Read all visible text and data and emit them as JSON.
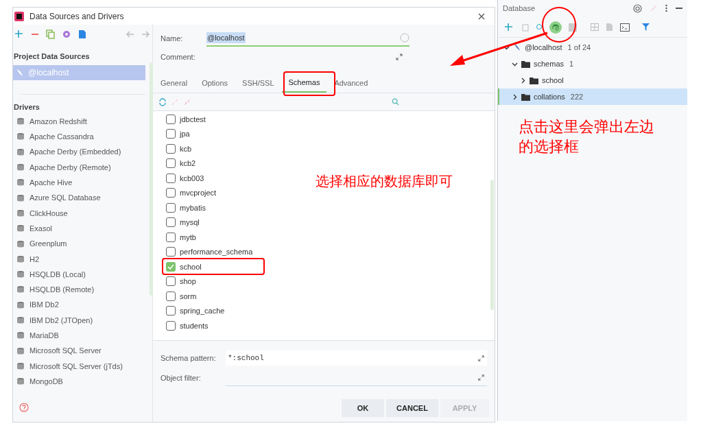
{
  "dialog": {
    "title": "Data Sources and Drivers",
    "project_section": "Project Data Sources",
    "project_items": [
      {
        "label": "@localhost",
        "selected": true
      }
    ],
    "drivers_section": "Drivers",
    "drivers": [
      "Amazon Redshift",
      "Apache Cassandra",
      "Apache Derby (Embedded)",
      "Apache Derby (Remote)",
      "Apache Hive",
      "Azure SQL Database",
      "ClickHouse",
      "Exasol",
      "Greenplum",
      "H2",
      "HSQLDB (Local)",
      "HSQLDB (Remote)",
      "IBM Db2",
      "IBM Db2 (JTOpen)",
      "MariaDB",
      "Microsoft SQL Server",
      "Microsoft SQL Server (jTds)",
      "MongoDB"
    ],
    "name_label": "Name:",
    "name_value": "@localhost",
    "comment_label": "Comment:",
    "tabs": [
      {
        "label": "General",
        "selected": false
      },
      {
        "label": "Options",
        "selected": false
      },
      {
        "label": "SSH/SSL",
        "selected": false
      },
      {
        "label": "Schemas",
        "selected": true
      },
      {
        "label": "Advanced",
        "selected": false
      }
    ],
    "schemas": [
      {
        "label": "jdbctest",
        "checked": false
      },
      {
        "label": "jpa",
        "checked": false
      },
      {
        "label": "kcb",
        "checked": false
      },
      {
        "label": "kcb2",
        "checked": false
      },
      {
        "label": "kcb003",
        "checked": false
      },
      {
        "label": "mvcproject",
        "checked": false
      },
      {
        "label": "mybatis",
        "checked": false
      },
      {
        "label": "mysql",
        "checked": false
      },
      {
        "label": "mytb",
        "checked": false
      },
      {
        "label": "performance_schema",
        "checked": false
      },
      {
        "label": "school",
        "checked": true
      },
      {
        "label": "shop",
        "checked": false
      },
      {
        "label": "sorm",
        "checked": false
      },
      {
        "label": "spring_cache",
        "checked": false
      },
      {
        "label": "students",
        "checked": false
      }
    ],
    "schema_pattern_label": "Schema pattern:",
    "schema_pattern_value": "*:school",
    "object_filter_label": "Object filter:",
    "buttons": [
      {
        "label": "OK",
        "disabled": false
      },
      {
        "label": "CANCEL",
        "disabled": false
      },
      {
        "label": "APPLY",
        "disabled": true
      }
    ]
  },
  "database_panel": {
    "title": "Database",
    "tree": [
      {
        "label": "@localhost",
        "count": "1 of 24",
        "expanded": true,
        "selected": false,
        "children": [
          {
            "label": "schemas",
            "count": "1",
            "expanded": true,
            "selected": false,
            "children": [
              {
                "label": "school",
                "expanded": false,
                "selected": false
              }
            ]
          },
          {
            "label": "collations",
            "count": "222",
            "expanded": false,
            "selected": true
          }
        ]
      }
    ]
  },
  "annotations": {
    "panel_note": "点击这里会弹出左边的选择框",
    "list_note": "选择相应的数据库即可"
  }
}
